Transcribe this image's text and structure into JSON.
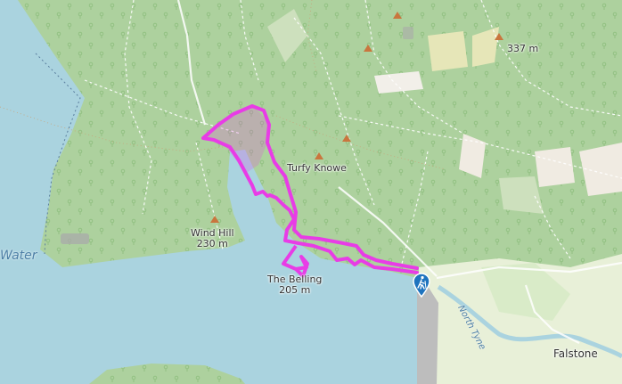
{
  "map": {
    "water_label": "Water",
    "river_label": "North Tyne",
    "places": [
      {
        "name": "Turfy Knowe",
        "elevation": ""
      },
      {
        "name": "Wind Hill",
        "elevation": "230 m"
      },
      {
        "name": "The Belling",
        "elevation": "205 m"
      },
      {
        "name": "",
        "elevation": "337 m"
      },
      {
        "name": "Falstone",
        "elevation": ""
      }
    ],
    "route_color": "#e83ce6",
    "water_color": "#aad3df",
    "forest_color": "#add19e",
    "marker_icon": "hiker-icon"
  }
}
